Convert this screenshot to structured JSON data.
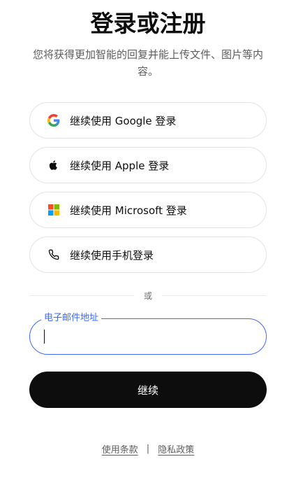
{
  "page": {
    "title": "登录或注册",
    "subtitle": "您将获得更加智能的回复并能上传文件、图片等内容。"
  },
  "oauth": [
    {
      "label": "继续使用 Google 登录",
      "icon": "google-icon"
    },
    {
      "label": "继续使用 Apple 登录",
      "icon": "apple-icon"
    },
    {
      "label": "继续使用 Microsoft 登录",
      "icon": "microsoft-icon"
    },
    {
      "label": "继续使用手机登录",
      "icon": "phone-icon"
    }
  ],
  "divider": {
    "text": "或"
  },
  "email": {
    "label": "电子邮件地址",
    "value": "",
    "placeholder": ""
  },
  "continue": {
    "label": "继续"
  },
  "footer": {
    "terms": "使用条款",
    "separator": "|",
    "privacy": "隐私政策"
  },
  "colors": {
    "accent": "#3e68ff",
    "primary_button": "#0d0d0d",
    "border": "#e3e3e3"
  }
}
